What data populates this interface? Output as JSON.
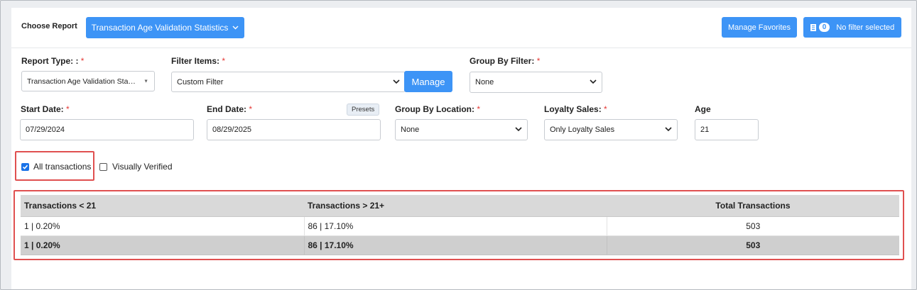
{
  "header": {
    "choose_report_label": "Choose Report",
    "report_button_label": "Transaction Age Validation Statistics",
    "manage_favorites_label": "Manage Favorites",
    "filter_count": "0",
    "filter_status_label": "No filter selected"
  },
  "form": {
    "report_type": {
      "label": "Report Type: :",
      "value": "Transaction Age Validation Stat…"
    },
    "filter_items": {
      "label": "Filter Items:",
      "value": "Custom Filter",
      "manage_label": "Manage"
    },
    "group_by_filter": {
      "label": "Group By Filter:",
      "value": "None"
    },
    "start_date": {
      "label": "Start Date:",
      "value": "07/29/2024"
    },
    "end_date": {
      "label": "End Date:",
      "value": "08/29/2025",
      "presets_label": "Presets"
    },
    "group_by_location": {
      "label": "Group By Location:",
      "value": "None"
    },
    "loyalty_sales": {
      "label": "Loyalty Sales:",
      "value": "Only Loyalty Sales"
    },
    "age": {
      "label": "Age",
      "value": "21"
    },
    "required_mark": "*"
  },
  "options": {
    "all_transactions": {
      "label": "All transactions",
      "checked": true
    },
    "visually_verified": {
      "label": "Visually Verified",
      "checked": false
    }
  },
  "table": {
    "columns": [
      "Transactions < 21",
      "Transactions > 21+",
      "Total Transactions"
    ],
    "rows": [
      [
        "1 | 0.20%",
        "86 | 17.10%",
        "503"
      ]
    ],
    "total_row": [
      "1 | 0.20%",
      "86 | 17.10%",
      "503"
    ]
  },
  "colors": {
    "accent": "#3d94f6",
    "highlight_border": "#e05050",
    "required": "#e53935"
  }
}
